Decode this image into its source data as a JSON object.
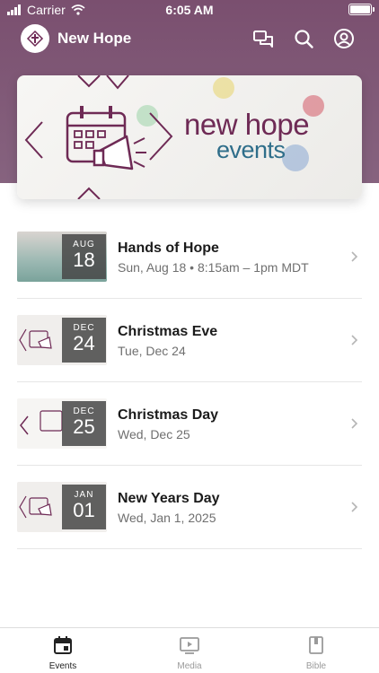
{
  "status_bar": {
    "carrier": "Carrier",
    "time": "6:05 AM"
  },
  "app_bar": {
    "title": "New Hope"
  },
  "banner": {
    "line1": "new hope",
    "line2": "events"
  },
  "events": [
    {
      "title": "Hands of Hope",
      "subtitle": "Sun, Aug 18 • 8:15am – 1pm MDT",
      "month": "AUG",
      "day": "18"
    },
    {
      "title": "Christmas Eve",
      "subtitle": "Tue, Dec 24",
      "month": "DEC",
      "day": "24"
    },
    {
      "title": "Christmas Day",
      "subtitle": "Wed, Dec 25",
      "month": "DEC",
      "day": "25"
    },
    {
      "title": "New Years Day",
      "subtitle": "Wed, Jan 1, 2025",
      "month": "JAN",
      "day": "01"
    }
  ],
  "tabs": [
    {
      "label": "Events",
      "icon": "calendar-icon",
      "active": true
    },
    {
      "label": "Media",
      "icon": "play-icon",
      "active": false
    },
    {
      "label": "Bible",
      "icon": "book-icon",
      "active": false
    }
  ],
  "colors": {
    "header": "#7a4f6f",
    "brand_purple": "#6e2a55",
    "brand_teal": "#2f6e8a"
  }
}
